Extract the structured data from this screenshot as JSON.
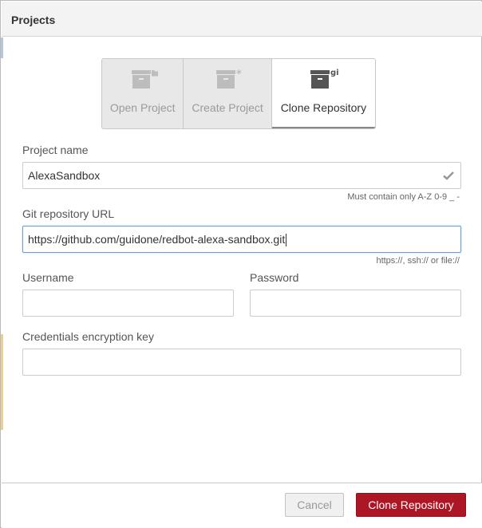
{
  "dialog": {
    "title": "Projects"
  },
  "tabs": [
    {
      "label": "Open Project",
      "icon": "archive-folder-icon",
      "selected": false
    },
    {
      "label": "Create Project",
      "icon": "archive-asterisk-icon",
      "selected": false
    },
    {
      "label": "Clone Repository",
      "icon": "archive-git-icon",
      "icon_text": "git",
      "selected": true
    }
  ],
  "form": {
    "project_name": {
      "label": "Project name",
      "value": "AlexaSandbox",
      "hint": "Must contain only A-Z 0-9 _ -",
      "valid_icon": "check-icon"
    },
    "git_url": {
      "label": "Git repository URL",
      "value": "https://github.com/guidone/redbot-alexa-sandbox.git",
      "hint": "https://, ssh:// or file://"
    },
    "username": {
      "label": "Username",
      "value": ""
    },
    "password": {
      "label": "Password",
      "value": ""
    },
    "credentials_key": {
      "label": "Credentials encryption key",
      "value": ""
    }
  },
  "footer": {
    "cancel_label": "Cancel",
    "primary_label": "Clone Repository"
  },
  "colors": {
    "primary": "#ad1625",
    "focus_border": "#6a9fd4",
    "titlebar_bg": "#f3f3f3"
  }
}
